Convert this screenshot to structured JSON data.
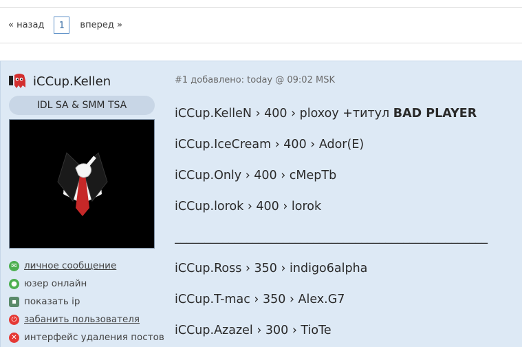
{
  "pager": {
    "prev_label": "« назад",
    "current_page": "1",
    "next_label": "вперед »"
  },
  "author": {
    "name": "iCCup.Kellen",
    "role": "IDL SA & SMM TSA",
    "actions": [
      {
        "icon": "envelope-icon",
        "label": "личное сообщение",
        "link": true,
        "color": "#4caf50"
      },
      {
        "icon": "online-status-icon",
        "label": "юзер онлайн",
        "link": false,
        "color": "#4caf50"
      },
      {
        "icon": "monitor-icon",
        "label": "показать ip",
        "link": false,
        "color": "#5a8a6a"
      },
      {
        "icon": "power-icon",
        "label": "забанить пользователя",
        "link": true,
        "color": "#e53935"
      },
      {
        "icon": "delete-icon",
        "label": "интерфейс удаления постов",
        "link": false,
        "color": "#e53935"
      }
    ]
  },
  "post": {
    "meta": "#1 добавлено: today @ 09:02 MSK",
    "line1_text": "iCCup.KelleN › 400 › ploxoy +титул ",
    "line1_bold": "BAD PLAYER",
    "lines_a": [
      "iCCup.IceCream › 400 › Ador(E)",
      "iCCup.Only › 400 › сМерТb",
      "iCCup.lorok › 400 › lorok"
    ],
    "rule": "____________________________________________________",
    "lines_b": [
      "iCCup.Ross › 350 › indigo6alpha",
      "iCCup.T-mac › 350 › Alex.G7",
      "iCCup.Azazel › 300 › TioTe"
    ]
  }
}
